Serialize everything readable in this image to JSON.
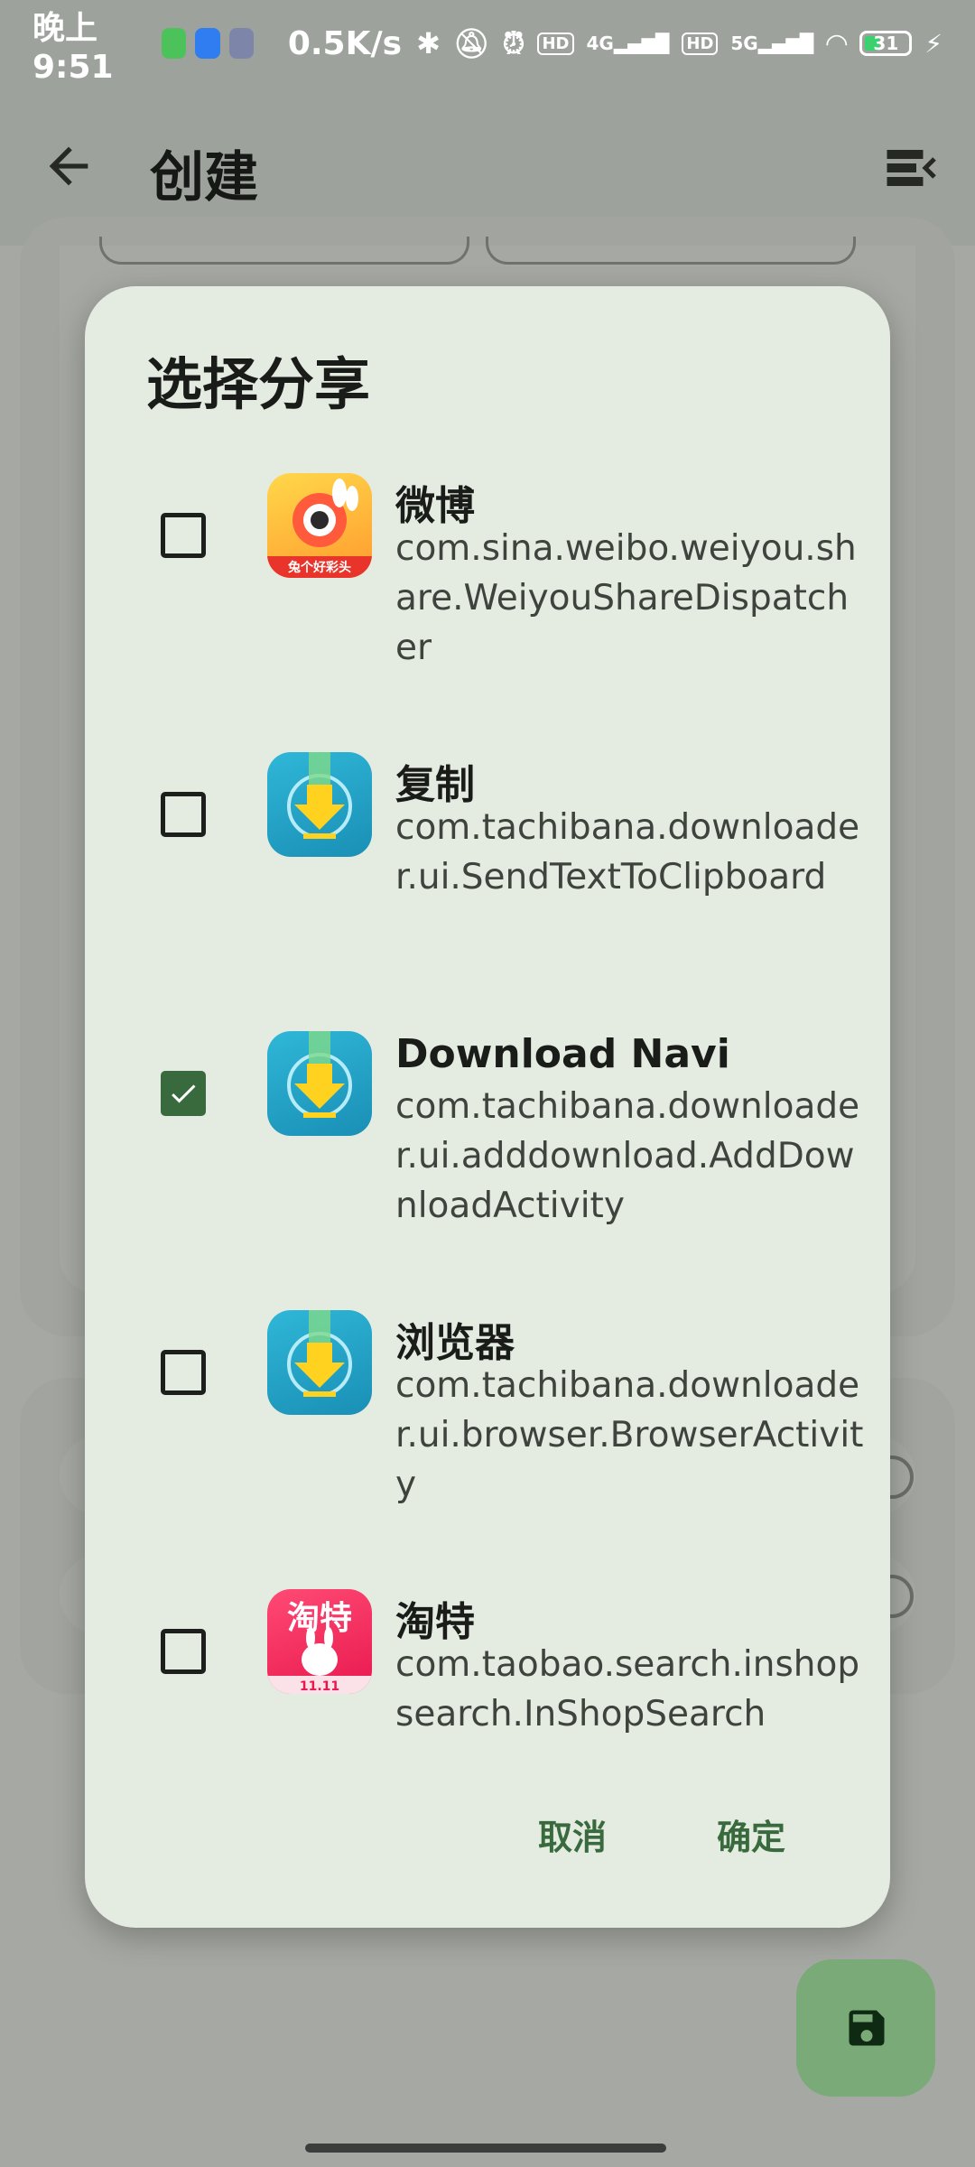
{
  "status_bar": {
    "time": "晚上9:51",
    "net_speed": "0.5K/s",
    "signal_1": "4G",
    "signal_2": "5G",
    "hd_1": "HD",
    "hd_2": "HD",
    "battery": "31"
  },
  "app_bar": {
    "title": "创建"
  },
  "dialog": {
    "title": "选择分享",
    "items": [
      {
        "name": "微博",
        "package": "com.sina.weibo.weiyou.share.WeiyouShareDispatcher",
        "checked": false,
        "icon": "weibo-app-icon"
      },
      {
        "name": "复制",
        "package": "com.tachibana.downloader.ui.SendTextToClipboard",
        "checked": false,
        "icon": "download-navi-app-icon"
      },
      {
        "name": "Download Navi",
        "package": "com.tachibana.downloader.ui.adddownload.AddDownloadActivity",
        "checked": true,
        "icon": "download-navi-app-icon"
      },
      {
        "name": "浏览器",
        "package": "com.tachibana.downloader.ui.browser.BrowserActivity",
        "checked": false,
        "icon": "download-navi-app-icon"
      },
      {
        "name": "淘特",
        "package": "com.taobao.search.inshopsearch.InShopSearch",
        "checked": false,
        "icon": "taote-app-icon"
      }
    ],
    "cancel_label": "取消",
    "confirm_label": "确定"
  },
  "icons": {
    "back": "arrow-left-icon",
    "menu": "menu-collapse-icon",
    "fab": "save-icon"
  },
  "colors": {
    "accent": "#386a3d",
    "dialog_bg": "#e4ebe1",
    "fab_bg": "#7aaa78",
    "scrim": "#a6a8a3"
  }
}
